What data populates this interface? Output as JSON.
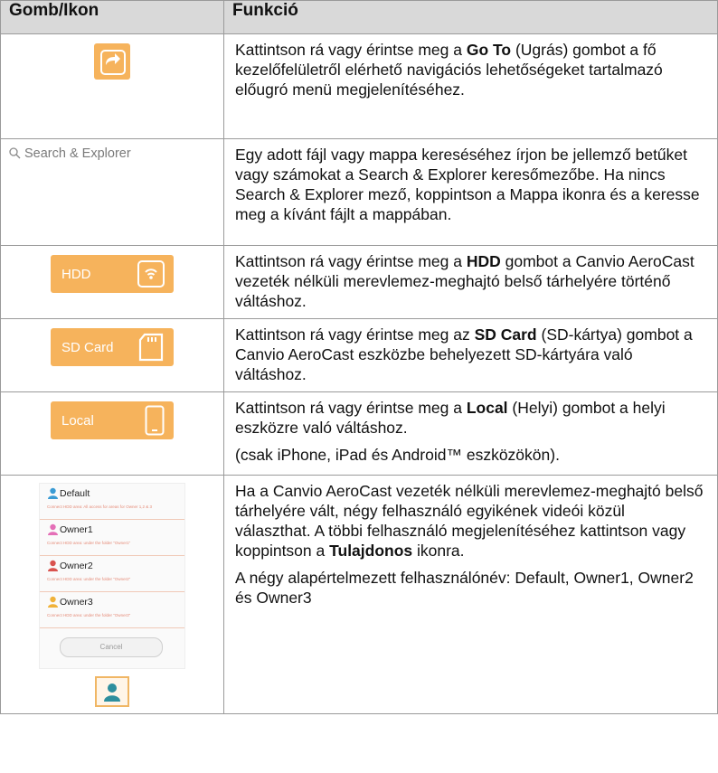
{
  "table": {
    "headers": [
      "Gomb/Ikon",
      "Funkció"
    ]
  },
  "rows": {
    "goto": {
      "icon": "go-to-icon",
      "parts": [
        "Kattintson rá vagy érintse meg a ",
        "Go To",
        " (Ugrás) gombot a fő kezelőfelületről elérhető navigációs lehetőségeket tartalmazó előugró menü megjelenítéséhez."
      ]
    },
    "search": {
      "label": "Search & Explorer",
      "text": "Egy adott fájl vagy mappa kereséséhez írjon be jellemző betűket vagy számokat a Search & Explorer keresőmezőbe. Ha nincs Search & Explorer mező, koppintson a Mappa ikonra és a keresse meg a kívánt fájlt a mappában."
    },
    "hdd": {
      "label": "HDD",
      "parts": [
        "Kattintson rá vagy érintse meg a ",
        "HDD",
        " gombot a Canvio AeroCast vezeték nélküli merevlemez-meghajtó belső tárhelyére történő váltáshoz."
      ]
    },
    "sd": {
      "label": "SD Card",
      "parts": [
        "Kattintson rá vagy érintse meg az ",
        "SD Card",
        " (SD-kártya) gombot a Canvio AeroCast eszközbe behelyezett SD-kártyára való váltáshoz."
      ]
    },
    "local": {
      "label": "Local",
      "parts": [
        "Kattintson rá vagy érintse meg a ",
        "Local",
        " (Helyi) gombot a helyi eszközre való váltáshoz."
      ],
      "note": "(csak iPhone, iPad és Android™ eszközökön)."
    },
    "owner": {
      "popup": [
        {
          "name": "Default",
          "sub": "Connect HDD area: All access for areas for Owner 1,2 & 3"
        },
        {
          "name": "Owner1",
          "sub": "Connect HDD area: under the folder \"Owner1\""
        },
        {
          "name": "Owner2",
          "sub": "Connect HDD area: under the folder \"Owner2\""
        },
        {
          "name": "Owner3",
          "sub": "Connect HDD area: under the folder \"Owner3\""
        }
      ],
      "cancel": "Cancel",
      "parts": [
        "Ha a Canvio AeroCast vezeték nélküli merevlemez-meghajtó belső tárhelyére vált, négy felhasználó egyikének videói közül választhat. A többi felhasználó megjelenítéséhez kattintson vagy koppintson a ",
        "Tulajdonos",
        " ikonra."
      ],
      "note": "A négy alapértelmezett felhasználónév: Default, Owner1, Owner2 és Owner3"
    }
  },
  "colors": {
    "accent": "#f6b35c",
    "header_bg": "#d9d9d9"
  }
}
